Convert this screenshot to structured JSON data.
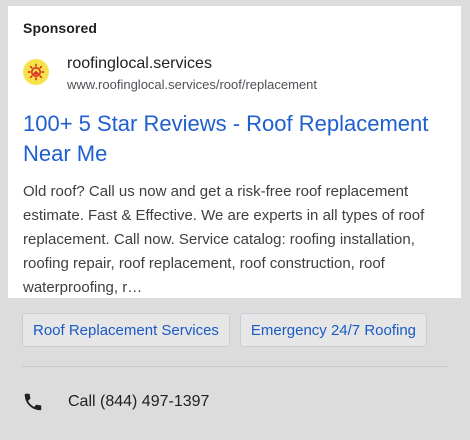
{
  "ad": {
    "sponsored_label": "Sponsored",
    "site_name": "roofinglocal.services",
    "site_url": "www.roofinglocal.services/roof/replacement",
    "title": "100+ 5 Star Reviews - Roof Replacement Near Me",
    "description": "Old roof? Call us now and get a risk-free roof replacement estimate. Fast & Effective. We are experts in all types of roof replacement. Call now. Service catalog: roofing installation, roofing repair, roof replacement, roof construction, roof waterproofing, r…",
    "favicon_icon": "gear-house-icon"
  },
  "sitelinks": [
    {
      "label": "Roof Replacement Services"
    },
    {
      "label": "Emergency 24/7 Roofing"
    }
  ],
  "call": {
    "icon": "phone-icon",
    "label": "Call (844) 497-1397"
  },
  "colors": {
    "link": "#1f5fd1",
    "chip_text": "#1a5ac7",
    "background": "#dcdcdc",
    "favicon_bg": "#f7e24c",
    "favicon_fg": "#d93025"
  }
}
